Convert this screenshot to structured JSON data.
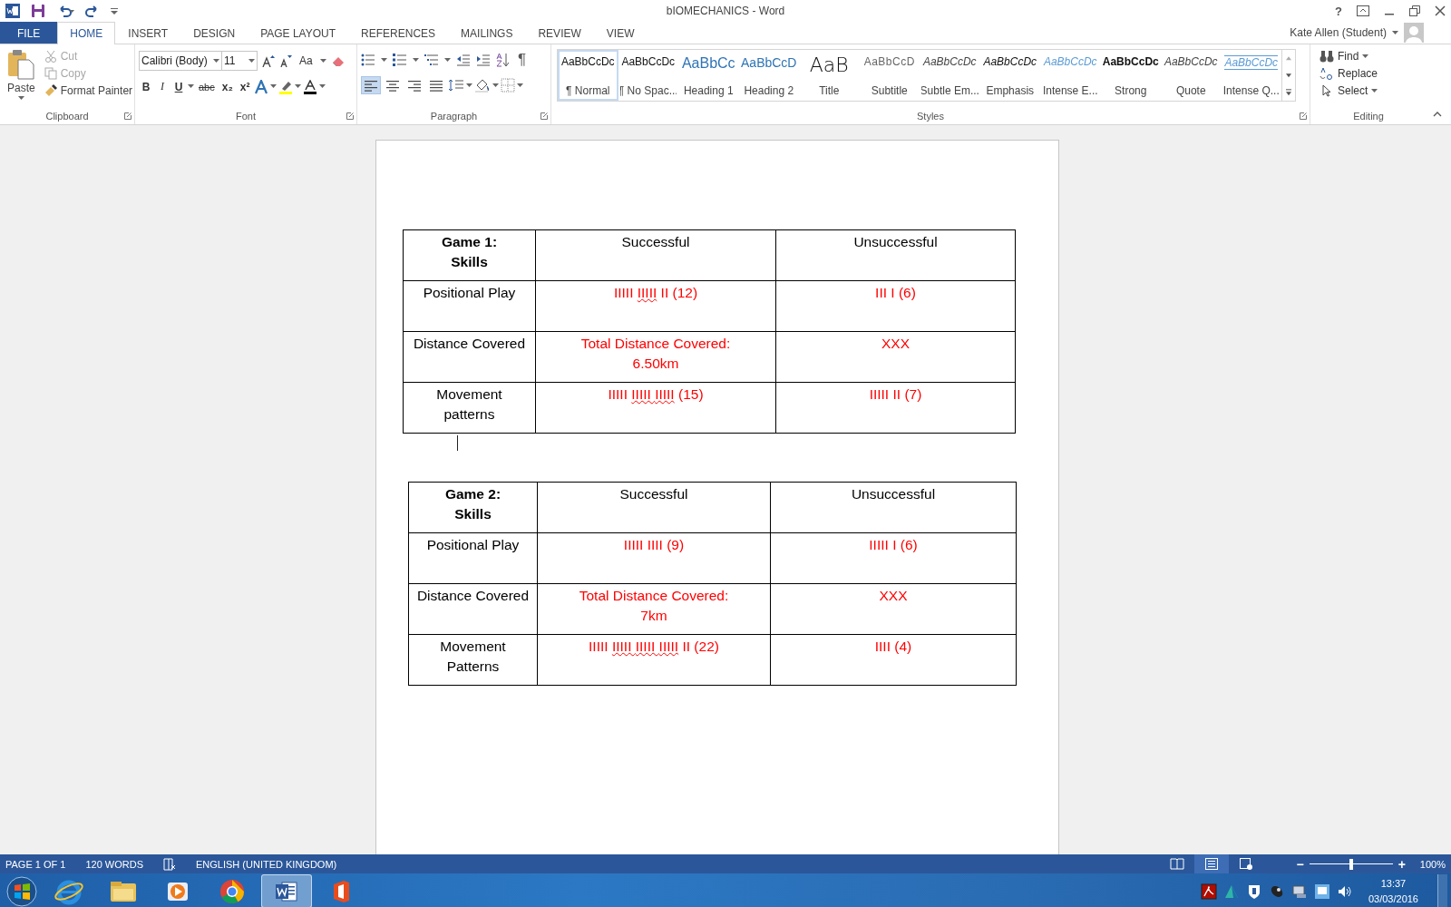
{
  "title_bar": {
    "title": "bIOMECHANICS - Word",
    "help": "?"
  },
  "tabs": [
    {
      "label": "FILE",
      "kind": "file",
      "selected": false
    },
    {
      "label": "HOME",
      "kind": "tab",
      "selected": true
    },
    {
      "label": "INSERT",
      "kind": "tab",
      "selected": false
    },
    {
      "label": "DESIGN",
      "kind": "tab",
      "selected": false
    },
    {
      "label": "PAGE LAYOUT",
      "kind": "tab",
      "selected": false
    },
    {
      "label": "REFERENCES",
      "kind": "tab",
      "selected": false
    },
    {
      "label": "MAILINGS",
      "kind": "tab",
      "selected": false
    },
    {
      "label": "REVIEW",
      "kind": "tab",
      "selected": false
    },
    {
      "label": "VIEW",
      "kind": "tab",
      "selected": false
    }
  ],
  "account": {
    "name": "Kate Allen (Student)"
  },
  "ribbon": {
    "clipboard": {
      "paste": "Paste",
      "items": [
        {
          "label": "Cut",
          "kind": "cut",
          "disabled": true
        },
        {
          "label": "Copy",
          "kind": "copy",
          "disabled": true
        },
        {
          "label": "Format Painter",
          "kind": "painter",
          "disabled": false
        }
      ],
      "group_label": "Clipboard"
    },
    "font": {
      "family": "Calibri (Body)",
      "size": "11",
      "change_case": "Aa",
      "format_buttons": [
        {
          "label": "B",
          "kind": "bold"
        },
        {
          "label": "I",
          "kind": "italic"
        },
        {
          "label": "U",
          "kind": "underline"
        },
        {
          "label": "abc",
          "kind": "strike"
        },
        {
          "label": "x₂",
          "kind": "sub"
        },
        {
          "label": "x²",
          "kind": "sup"
        }
      ],
      "group_label": "Font"
    },
    "paragraph": {
      "alignments": [
        {
          "kind": "left",
          "selected": true
        },
        {
          "kind": "center",
          "selected": false
        },
        {
          "kind": "right",
          "selected": false
        },
        {
          "kind": "justify",
          "selected": false
        }
      ],
      "pilcrow": "¶",
      "group_label": "Paragraph"
    },
    "styles": {
      "items": [
        {
          "preview": "AaBbCcDc",
          "name": "¶ Normal",
          "kind": "normal",
          "selected": true
        },
        {
          "preview": "AaBbCcDc",
          "name": "¶ No Spac...",
          "kind": "normal",
          "selected": false
        },
        {
          "preview": "AaBbCc",
          "name": "Heading 1",
          "kind": "heading1",
          "selected": false
        },
        {
          "preview": "AaBbCcD",
          "name": "Heading 2",
          "kind": "heading2",
          "selected": false
        },
        {
          "preview": "AaB",
          "name": "Title",
          "kind": "title",
          "selected": false
        },
        {
          "preview": "AaBbCcD",
          "name": "Subtitle",
          "kind": "subtitle",
          "selected": false
        },
        {
          "preview": "AaBbCcDc",
          "name": "Subtle Em...",
          "kind": "subtle",
          "selected": false
        },
        {
          "preview": "AaBbCcDc",
          "name": "Emphasis",
          "kind": "emphasis",
          "selected": false
        },
        {
          "preview": "AaBbCcDc",
          "name": "Intense E...",
          "kind": "intense",
          "selected": false
        },
        {
          "preview": "AaBbCcDc",
          "name": "Strong",
          "kind": "strong",
          "selected": false
        },
        {
          "preview": "AaBbCcDc",
          "name": "Quote",
          "kind": "subtle",
          "selected": false
        },
        {
          "preview": "AaBbCcDc",
          "name": "Intense Q...",
          "kind": "intensequote",
          "selected": false
        }
      ],
      "group_label": "Styles"
    },
    "editing": {
      "items": [
        {
          "label": "Find",
          "kind": "find"
        },
        {
          "label": "Replace",
          "kind": "replace"
        },
        {
          "label": "Select",
          "kind": "select"
        }
      ],
      "group_label": "Editing"
    }
  },
  "document": {
    "tables": [
      {
        "rows": [
          [
            {
              "kind": "title",
              "lines": [
                "Game 1:",
                "Skills"
              ]
            },
            {
              "kind": "label",
              "lines": [
                "Successful"
              ]
            },
            {
              "kind": "label",
              "lines": [
                "Unsuccessful"
              ]
            }
          ],
          [
            {
              "kind": "label",
              "lines": [
                "Positional Play"
              ]
            },
            {
              "kind": "value",
              "parts": [
                {
                  "text": "IIIII ",
                  "flagged": false
                },
                {
                  "text": "IIIII",
                  "flagged": true
                },
                {
                  "text": " II (12)",
                  "flagged": false
                }
              ]
            },
            {
              "kind": "value",
              "lines": [
                "III I (6)"
              ]
            }
          ],
          [
            {
              "kind": "label",
              "lines": [
                "Distance Covered"
              ]
            },
            {
              "kind": "value",
              "lines": [
                "Total Distance Covered:",
                "6.50km"
              ]
            },
            {
              "kind": "value",
              "lines": [
                "XXX"
              ]
            }
          ],
          [
            {
              "kind": "label",
              "lines": [
                "Movement",
                "patterns"
              ]
            },
            {
              "kind": "value",
              "parts": [
                {
                  "text": "IIIII ",
                  "flagged": false
                },
                {
                  "text": "IIIII ",
                  "flagged": true
                },
                {
                  "text": "IIIII",
                  "flagged": true
                },
                {
                  "text": " (15)",
                  "flagged": false
                }
              ]
            },
            {
              "kind": "value",
              "lines": [
                "IIIII II (7)"
              ]
            }
          ]
        ]
      },
      {
        "rows": [
          [
            {
              "kind": "title",
              "lines": [
                "Game 2:",
                "Skills"
              ]
            },
            {
              "kind": "label",
              "lines": [
                "Successful"
              ]
            },
            {
              "kind": "label",
              "lines": [
                "Unsuccessful"
              ]
            }
          ],
          [
            {
              "kind": "label",
              "lines": [
                "Positional Play"
              ]
            },
            {
              "kind": "value",
              "lines": [
                "IIIII IIII (9)"
              ]
            },
            {
              "kind": "value",
              "lines": [
                "IIIII I (6)"
              ]
            }
          ],
          [
            {
              "kind": "label",
              "lines": [
                "Distance Covered"
              ]
            },
            {
              "kind": "value",
              "lines": [
                "Total Distance Covered:",
                "7km"
              ]
            },
            {
              "kind": "value",
              "lines": [
                "XXX"
              ]
            }
          ],
          [
            {
              "kind": "label",
              "lines": [
                "Movement",
                "Patterns"
              ]
            },
            {
              "kind": "value",
              "parts": [
                {
                  "text": "IIIII ",
                  "flagged": false
                },
                {
                  "text": "IIIII ",
                  "flagged": true
                },
                {
                  "text": "IIIII ",
                  "flagged": true
                },
                {
                  "text": "IIIII",
                  "flagged": true
                },
                {
                  "text": " II (22)",
                  "flagged": false
                }
              ]
            },
            {
              "kind": "value",
              "lines": [
                "IIII (4)"
              ]
            }
          ]
        ]
      }
    ]
  },
  "status_bar": {
    "page": "PAGE 1 OF 1",
    "words": "120 WORDS",
    "language": "ENGLISH (UNITED KINGDOM)",
    "views": [
      {
        "kind": "read",
        "selected": false
      },
      {
        "kind": "print",
        "selected": true
      },
      {
        "kind": "web",
        "selected": false
      }
    ],
    "zoom": {
      "minus": "−",
      "plus": "+",
      "level": 0.5,
      "percent": "100%"
    }
  },
  "taskbar": {
    "apps": [
      {
        "kind": "ie",
        "selected": false
      },
      {
        "kind": "folder",
        "selected": false
      },
      {
        "kind": "media",
        "selected": false
      },
      {
        "kind": "chrome",
        "selected": false
      },
      {
        "kind": "word",
        "selected": true
      },
      {
        "kind": "office",
        "selected": false
      }
    ],
    "tray": [
      {
        "kind": "acrobat"
      },
      {
        "kind": "autodesk"
      },
      {
        "kind": "shield"
      },
      {
        "kind": "satellite"
      },
      {
        "kind": "network"
      },
      {
        "kind": "monitor"
      },
      {
        "kind": "volume"
      }
    ],
    "clock": {
      "time": "13:37",
      "date": "03/03/2016"
    }
  }
}
